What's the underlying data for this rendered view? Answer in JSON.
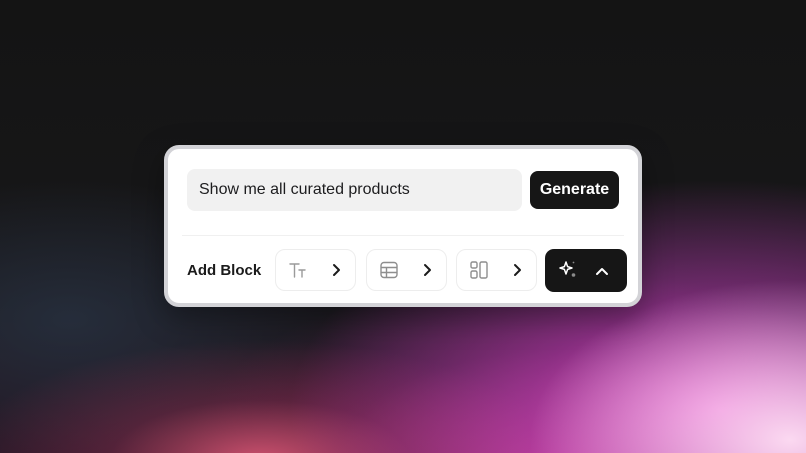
{
  "prompt": {
    "value": "Show me all curated products"
  },
  "generate_label": "Generate",
  "add_block_label": "Add Block",
  "block_buttons": [
    {
      "icon": "text-size-icon"
    },
    {
      "icon": "table-icon"
    },
    {
      "icon": "layout-icon"
    }
  ],
  "ai_button": {
    "icon": "sparkle-icon",
    "chevron": "chevron-up-icon"
  },
  "colors": {
    "accent_dark": "#161616",
    "input_bg": "#f1f1f1"
  }
}
